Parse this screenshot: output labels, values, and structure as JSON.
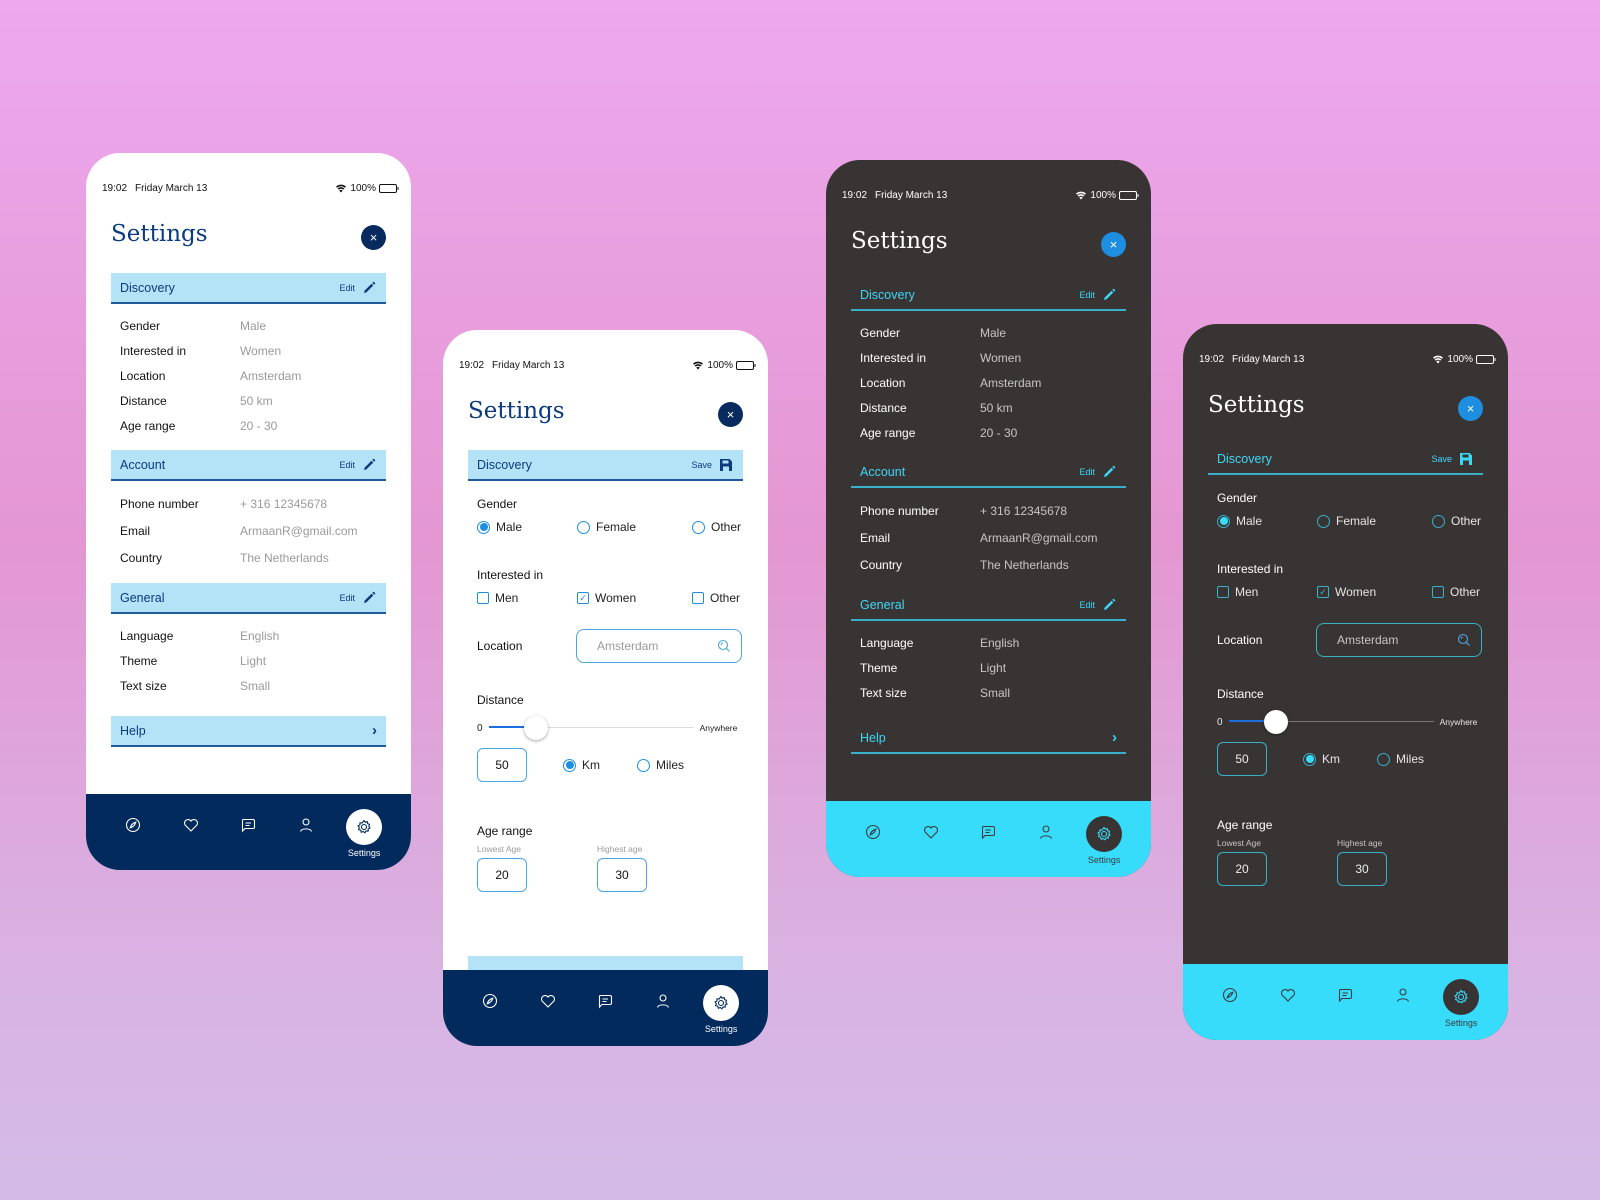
{
  "status_bar": {
    "time": "19:02",
    "date": "Friday March 13",
    "battery": "100%"
  },
  "title": "Settings",
  "close_icon": "×",
  "view_screen": {
    "sections": [
      {
        "title": "Discovery",
        "action": "Edit",
        "rows": [
          {
            "label": "Gender",
            "value": "Male"
          },
          {
            "label": "Interested in",
            "value": "Women"
          },
          {
            "label": "Location",
            "value": "Amsterdam"
          },
          {
            "label": "Distance",
            "value": "50 km"
          },
          {
            "label": "Age range",
            "value": "20 - 30"
          }
        ]
      },
      {
        "title": "Account",
        "action": "Edit",
        "rows": [
          {
            "label": "Phone number",
            "value": "+ 316 12345678"
          },
          {
            "label": "Email",
            "value": "ArmaanR@gmail.com"
          },
          {
            "label": "Country",
            "value": "The Netherlands"
          }
        ]
      },
      {
        "title": "General",
        "action": "Edit",
        "rows": [
          {
            "label": "Language",
            "value": "English"
          },
          {
            "label": "Theme",
            "value": "Light"
          },
          {
            "label": "Text size",
            "value": "Small"
          }
        ]
      }
    ],
    "help": {
      "label": "Help",
      "chevron": "›"
    }
  },
  "edit_screen": {
    "section_title": "Discovery",
    "save_label": "Save",
    "gender": {
      "label": "Gender",
      "options": [
        "Male",
        "Female",
        "Other"
      ],
      "selected": "Male"
    },
    "interested": {
      "label": "Interested in",
      "options": [
        "Men",
        "Women",
        "Other"
      ],
      "checked": [
        "Women"
      ]
    },
    "location": {
      "label": "Location",
      "value": "Amsterdam"
    },
    "distance": {
      "label": "Distance",
      "min": "0",
      "max": "Anywhere",
      "slider_fraction": 0.23,
      "value": "50",
      "units": [
        "Km",
        "Miles"
      ],
      "selected_unit": "Km"
    },
    "age_range": {
      "label": "Age range",
      "lowest_label": "Lowest Age",
      "lowest": "20",
      "highest_label": "Highest age",
      "highest": "30"
    }
  },
  "nav": {
    "items": [
      "explore",
      "likes",
      "messages",
      "profile",
      "settings"
    ],
    "active_label": "Settings"
  },
  "colors": {
    "light_accent": "#0b3a7e",
    "light_nav": "#022a5c",
    "dark_bg": "#393434",
    "dark_accent": "#38dcfb",
    "header_bg": "#b4e3f8"
  }
}
